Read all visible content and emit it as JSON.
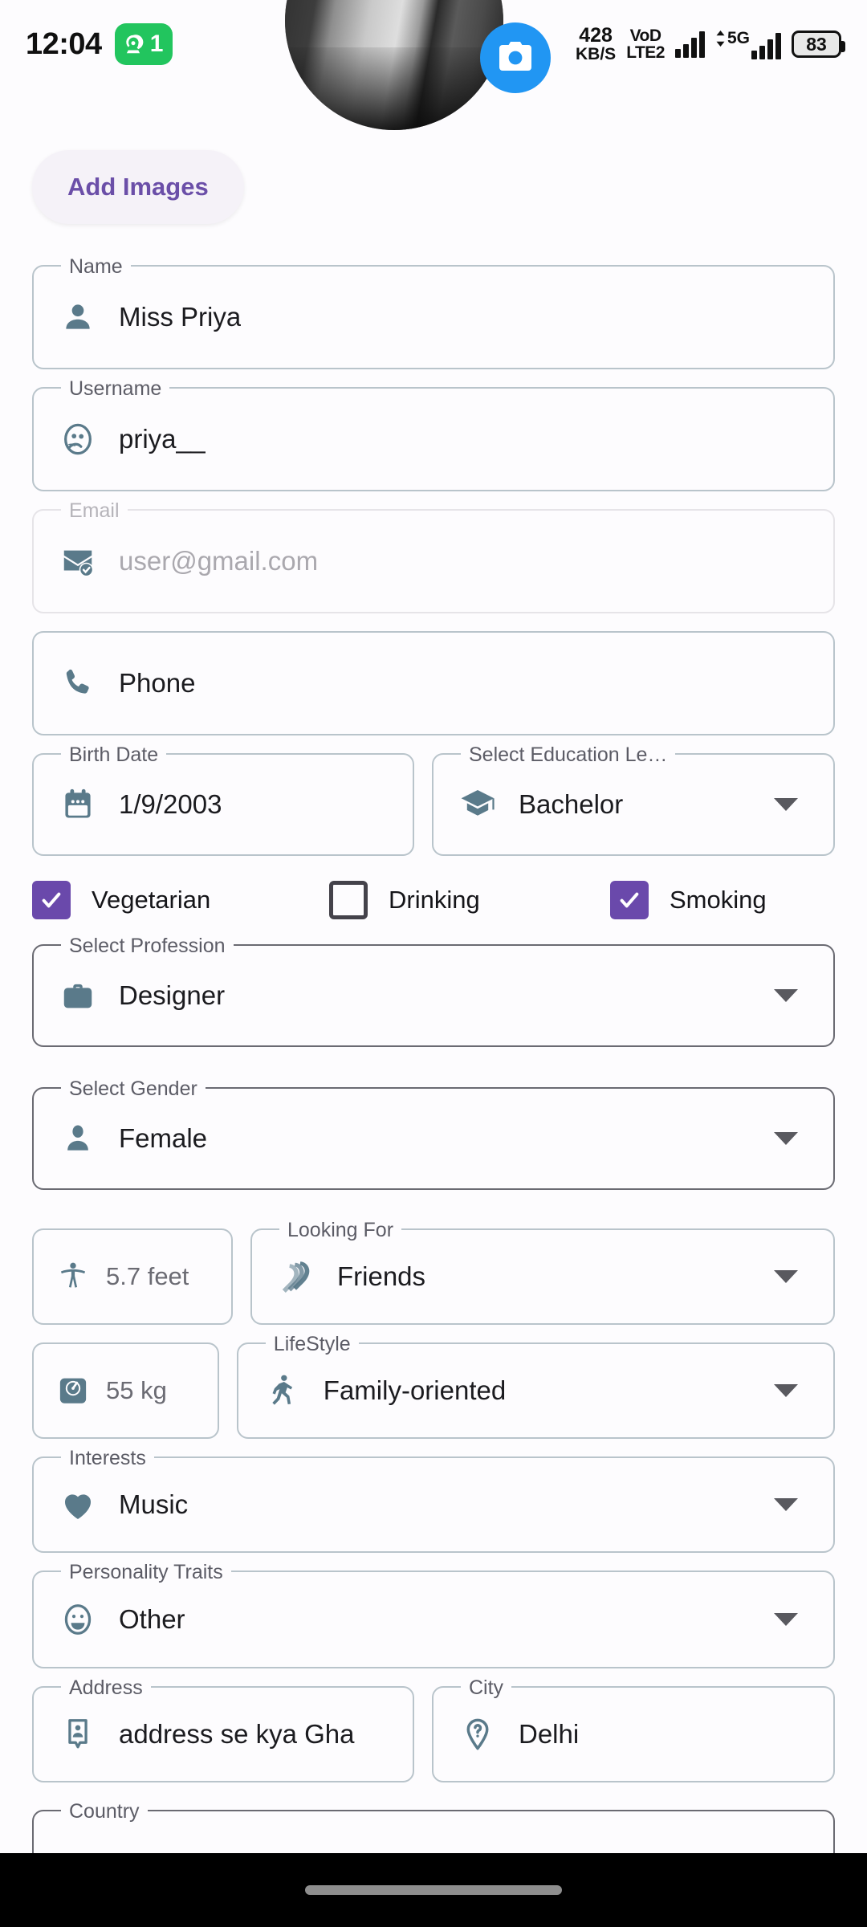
{
  "status_bar": {
    "clock": "12:04",
    "hotspot_count": "1",
    "net_speed_value": "428",
    "net_speed_unit": "KB/S",
    "volte_line1": "VoD",
    "volte_line2": "LTE2",
    "network_type": "5G",
    "battery_percent": "83"
  },
  "header": {
    "camera_button_icon": "camera-icon",
    "avatar_alt": "profile-photo",
    "add_images_label": "Add Images"
  },
  "form": {
    "name": {
      "legend": "Name",
      "value": "Miss Priya",
      "icon": "person-icon"
    },
    "username": {
      "legend": "Username",
      "value": "priya__",
      "icon": "user-badge-icon"
    },
    "email": {
      "legend": "Email",
      "placeholder": "user@gmail.com",
      "value": "",
      "icon": "email-verified-icon"
    },
    "phone": {
      "legend": "",
      "placeholder": "Phone",
      "value": "",
      "icon": "phone-icon"
    },
    "birth_date": {
      "legend": "Birth Date",
      "value": "1/9/2003",
      "icon": "calendar-icon"
    },
    "education": {
      "legend": "Select Education Le…",
      "value": "Bachelor",
      "icon": "graduation-cap-icon"
    },
    "checkboxes": [
      {
        "label": "Vegetarian",
        "checked": true
      },
      {
        "label": "Drinking",
        "checked": false
      },
      {
        "label": "Smoking",
        "checked": true
      }
    ],
    "profession": {
      "legend": "Select Profession",
      "value": "Designer",
      "icon": "briefcase-icon"
    },
    "gender": {
      "legend": "Select Gender",
      "value": "Female",
      "icon": "person-icon"
    },
    "height": {
      "value": "5.7 feet",
      "icon": "height-person-icon"
    },
    "looking_for": {
      "legend": "Looking For",
      "value": "Friends",
      "icon": "handshake-icon"
    },
    "weight": {
      "value": "55 kg",
      "icon": "weight-scale-icon"
    },
    "lifestyle": {
      "legend": "LifeStyle",
      "value": "Family-oriented",
      "icon": "running-person-icon"
    },
    "interests": {
      "legend": "Interests",
      "value": "Music",
      "icon": "heart-icon"
    },
    "personality": {
      "legend": "Personality Traits",
      "value": "Other",
      "icon": "smiley-face-icon"
    },
    "address": {
      "legend": "Address",
      "value": "address se kya Gha",
      "icon": "address-pin-icon"
    },
    "city": {
      "legend": "City",
      "value": "Delhi",
      "icon": "location-question-icon"
    },
    "country": {
      "legend": "Country",
      "value": ""
    }
  },
  "colors": {
    "accent_purple": "#6a49ab",
    "camera_blue": "#2196f3",
    "icon_slate": "#5a7a8a",
    "hotspot_green": "#22c55e",
    "border_default": "#b9c4cb",
    "border_dark": "#6a6a72",
    "border_light": "#e6e4e8"
  }
}
